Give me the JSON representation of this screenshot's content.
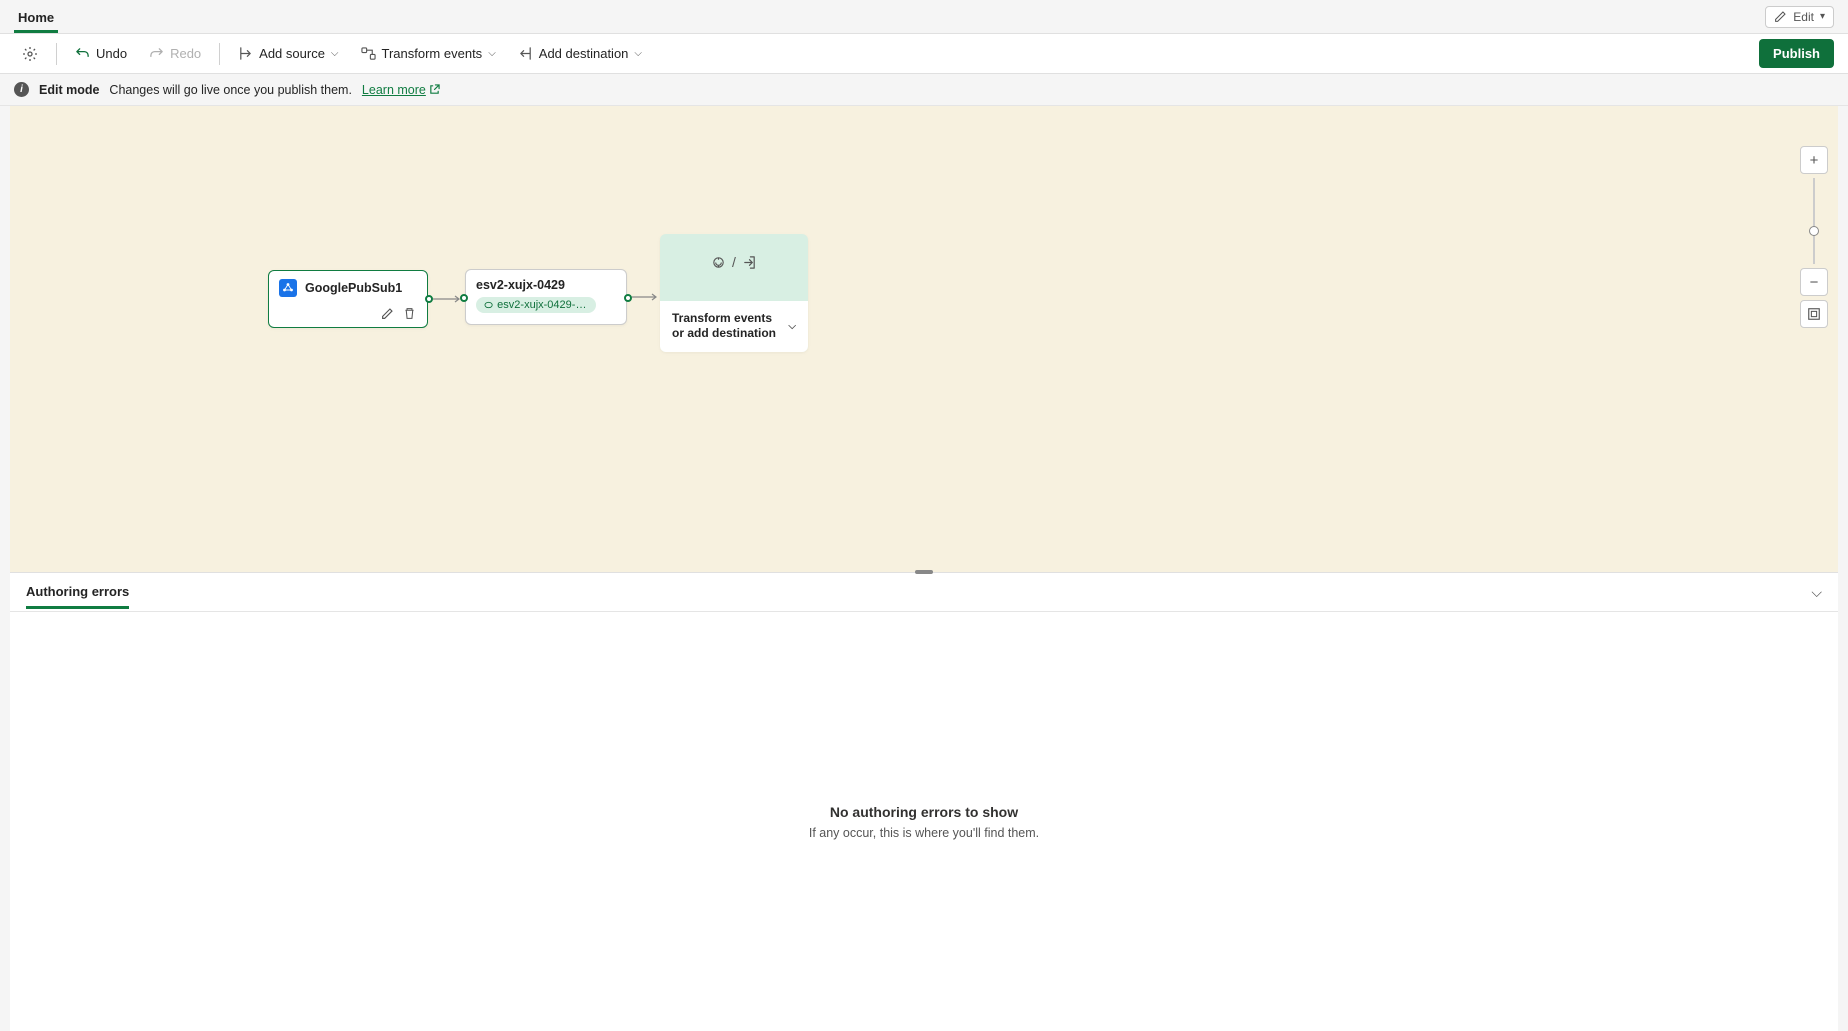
{
  "tabs": {
    "home": "Home"
  },
  "edit_dropdown": "Edit",
  "toolbar": {
    "undo": "Undo",
    "redo": "Redo",
    "add_source": "Add source",
    "transform_events": "Transform events",
    "add_destination": "Add destination",
    "publish": "Publish"
  },
  "infobar": {
    "mode": "Edit mode",
    "message": "Changes will go live once you publish them.",
    "learn_more": "Learn more"
  },
  "nodes": {
    "source": {
      "title": "GooglePubSub1"
    },
    "stream": {
      "title": "esv2-xujx-0429",
      "pill": "esv2-xujx-0429-str..."
    },
    "target": {
      "label": "Transform events or add destination"
    }
  },
  "panel": {
    "tab": "Authoring errors",
    "empty_title": "No authoring errors to show",
    "empty_sub": "If any occur, this is where you'll find them."
  }
}
